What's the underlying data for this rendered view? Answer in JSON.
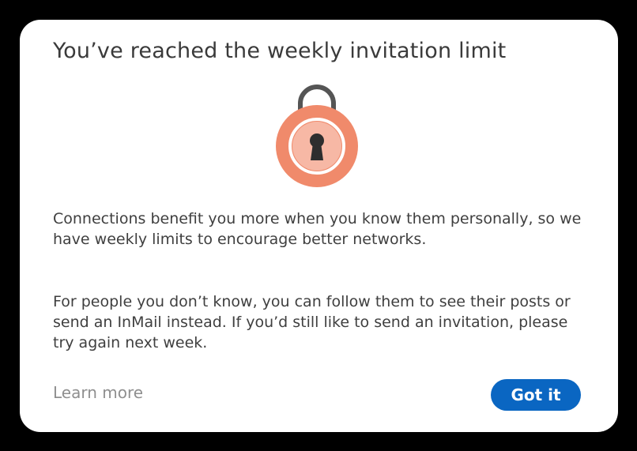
{
  "dialog": {
    "title": "You’ve reached the weekly invitation limit",
    "paragraphs": [
      "Connections benefit you more when you know them personally, so we have weekly limits to encourage better networks.",
      "For people you don’t know, you can follow them to see their posts or send an InMail instead. If you’d still like to send an invitation, please try again next week."
    ],
    "learn_more_label": "Learn more",
    "got_it_label": "Got it"
  },
  "illustration": {
    "icon": "padlock-icon",
    "lock_body_color": "#f08a6b",
    "lock_face_color": "#f7b8a5",
    "shackle_color": "#555555",
    "keyhole_color": "#2e2e2e"
  },
  "colors": {
    "accent": "#0a66c2",
    "background": "#000000",
    "dialog": "#ffffff"
  }
}
